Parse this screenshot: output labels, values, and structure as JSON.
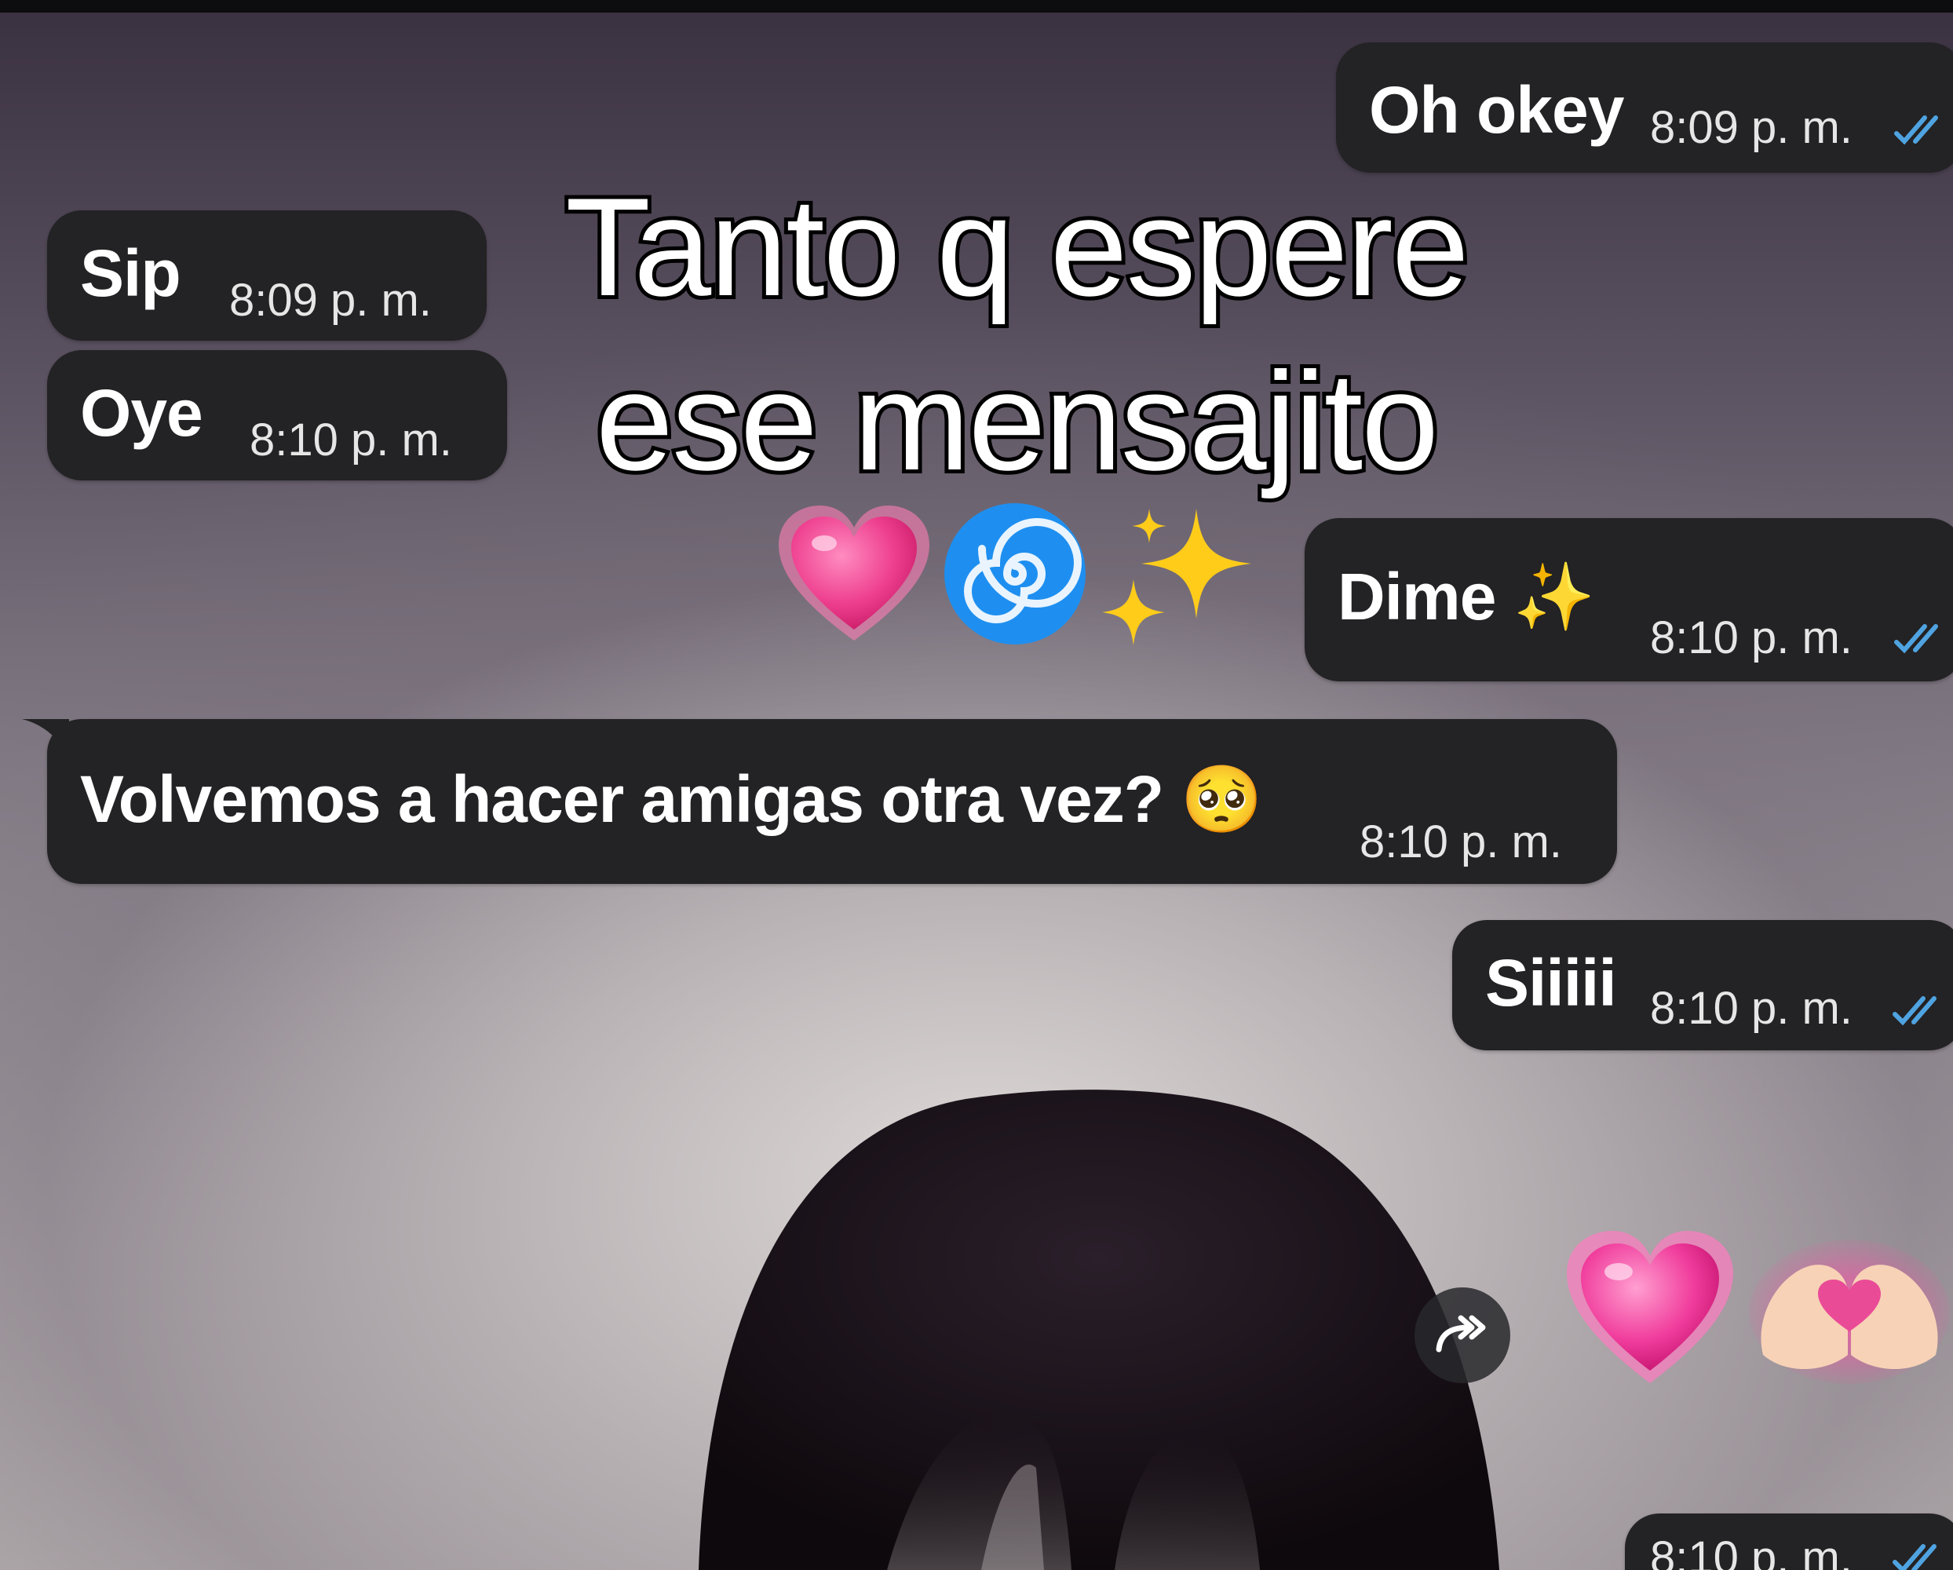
{
  "caption": {
    "line1": "Tanto q espere",
    "line2": "ese mensajito",
    "emojis": [
      "growing-heart",
      "cyclone",
      "sparkles"
    ]
  },
  "messages": [
    {
      "id": "m1",
      "direction": "outgoing",
      "text": "Oh okey",
      "time": "8:09 p. m.",
      "read": true
    },
    {
      "id": "m2",
      "direction": "incoming",
      "text": "Sip",
      "time": "8:09 p. m."
    },
    {
      "id": "m3",
      "direction": "incoming",
      "text": "Oye",
      "time": "8:10 p. m."
    },
    {
      "id": "m4",
      "direction": "outgoing",
      "text": "Dime ✨",
      "time": "8:10 p. m.",
      "read": true
    },
    {
      "id": "m5",
      "direction": "incoming",
      "text": "Volvemos a hacer amigas otra vez? 🥺",
      "time": "8:10 p. m."
    },
    {
      "id": "m6",
      "direction": "outgoing",
      "text": "Siiiii",
      "time": "8:10 p. m.",
      "read": true
    },
    {
      "id": "m7",
      "direction": "outgoing",
      "type": "emoji",
      "emojis": [
        "growing-heart",
        "heart-hands"
      ]
    },
    {
      "id": "m8",
      "direction": "outgoing",
      "time": "8:10 p. m.",
      "read": true
    }
  ],
  "colors": {
    "bubble": "#232224",
    "read_ticks": "#4fa3e0",
    "caption_fill": "#ffffff",
    "caption_stroke": "#000000"
  },
  "icons": {
    "forward": "forward-icon",
    "read_receipt": "double-check-icon"
  }
}
